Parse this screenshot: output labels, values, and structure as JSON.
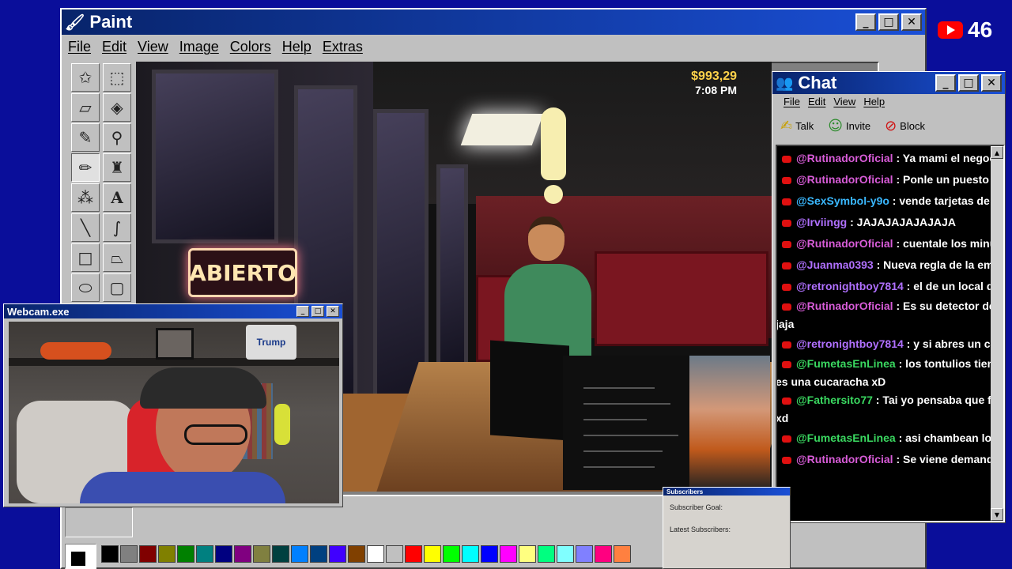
{
  "paint": {
    "title": "Paint",
    "menu": [
      "File",
      "Edit",
      "View",
      "Image",
      "Colors",
      "Help",
      "Extras"
    ],
    "tools": [
      "free-select",
      "rect-select",
      "eraser",
      "fill",
      "color-picker",
      "magnifier",
      "pencil",
      "brush",
      "airbrush",
      "text",
      "line",
      "curve",
      "rectangle",
      "polygon",
      "ellipse",
      "rounded-rectangle"
    ],
    "active_tool": "pencil",
    "palette": [
      "#000000",
      "#808080",
      "#800000",
      "#808000",
      "#008000",
      "#008080",
      "#000080",
      "#800080",
      "#808040",
      "#004040",
      "#0080ff",
      "#004080",
      "#4000ff",
      "#804000",
      "#ffffff",
      "#c0c0c0",
      "#ff0000",
      "#ffff00",
      "#00ff00",
      "#00ffff",
      "#0000ff",
      "#ff00ff",
      "#ffff80",
      "#00ff80",
      "#80ffff",
      "#8080ff",
      "#ff0080",
      "#ff8040"
    ]
  },
  "game": {
    "money": "$993,29",
    "time": "7:08 PM",
    "sign": "ABIERTO"
  },
  "webcam": {
    "title": "Webcam.exe",
    "can_label": "Trump"
  },
  "chat": {
    "title": "Chat",
    "menu": [
      "File",
      "Edit",
      "View",
      "Help"
    ],
    "toolbar": {
      "talk": "Talk",
      "invite": "Invite",
      "block": "Block"
    },
    "messages": [
      {
        "user": "@RutinadorOficial",
        "color": "#d85cd8",
        "text": " : Ya mami el negocio de l"
      },
      {
        "user": "@RutinadorOficial",
        "color": "#d85cd8",
        "text": " : Ponle un puesto de ques"
      },
      {
        "user": "@SexSymbol-y9o",
        "color": "#3ab8ff",
        "text": " : vende tarjetas de Pokém"
      },
      {
        "user": "@Irviingg",
        "color": "#b070ff",
        "text": " : JAJAJAJAJAJAJA"
      },
      {
        "user": "@RutinadorOficial",
        "color": "#d85cd8",
        "text": " : cuentale los minutos"
      },
      {
        "user": "@Juanma0393",
        "color": "#b070ff",
        "text": " : Nueva regla de la empres"
      },
      {
        "user": "@retronightboy7814",
        "color": "#b070ff",
        "text": " : el de un local de carti"
      },
      {
        "user": "@RutinadorOficial",
        "color": "#d85cd8",
        "text": " : Es su detector de menti",
        "cont": "jaja"
      },
      {
        "user": "@retronightboy7814",
        "color": "#b070ff",
        "text": " : y si abres un café inte"
      },
      {
        "user": "@FumetasEnLinea",
        "color": "#3ad860",
        "text": " : los tontulios tienen mie",
        "cont": "es una cucaracha xD"
      },
      {
        "user": "@Fathersito77",
        "color": "#3ad860",
        "text": " : Tai yo pensaba que fifita era",
        "cont": "xd"
      },
      {
        "user": "@FumetasEnLinea",
        "color": "#3ad860",
        "text": " : asi chambean los jefes"
      },
      {
        "user": "@RutinadorOficial",
        "color": "#d85cd8",
        "text": " : Se viene demanda 😭"
      }
    ]
  },
  "subscribers": {
    "title": "Subscribers",
    "goal_label": "Subscriber Goal:",
    "latest_label": "Latest Subscribers:"
  },
  "youtube": {
    "viewer_count": "46",
    "brand_color": "#ff0000"
  }
}
